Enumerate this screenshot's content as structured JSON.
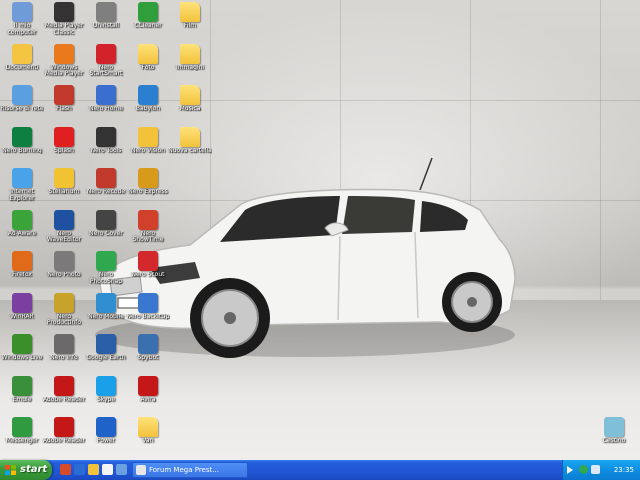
{
  "desktop": {
    "icons": [
      {
        "label": "Il mio computer",
        "kind": "computer",
        "color": "#6f9bd8"
      },
      {
        "label": "Media Player Classic",
        "kind": "media",
        "color": "#333333"
      },
      {
        "label": "Uninstall",
        "kind": "app",
        "color": "#7f7f7f"
      },
      {
        "label": "CCleaner",
        "kind": "app",
        "color": "#2f9e3b"
      },
      {
        "label": "Film",
        "kind": "folder",
        "color": "#f2c23b"
      },
      {
        "label": "Documenti",
        "kind": "docs",
        "color": "#f4c542"
      },
      {
        "label": "Windows Media Player",
        "kind": "media",
        "color": "#e87a1d"
      },
      {
        "label": "Nero StartSmart",
        "kind": "app",
        "color": "#d2232a"
      },
      {
        "label": "Foto",
        "kind": "folder",
        "color": "#f2c23b"
      },
      {
        "label": "Immagini",
        "kind": "folder",
        "color": "#f2c23b"
      },
      {
        "label": "Risorse di rete",
        "kind": "network",
        "color": "#5aa0e0"
      },
      {
        "label": "Flash",
        "kind": "app",
        "color": "#c0392b"
      },
      {
        "label": "Nero Home",
        "kind": "app",
        "color": "#3a6fd0"
      },
      {
        "label": "Babylon",
        "kind": "app",
        "color": "#2b7fd1"
      },
      {
        "label": "Musica",
        "kind": "folder",
        "color": "#f2c23b"
      },
      {
        "label": "Nero Burning",
        "kind": "app",
        "color": "#0f7f3f"
      },
      {
        "label": "Splash",
        "kind": "app",
        "color": "#e02020"
      },
      {
        "label": "Nero Tools",
        "kind": "app",
        "color": "#333333"
      },
      {
        "label": "Nero Vision",
        "kind": "app",
        "color": "#f2c23b"
      },
      {
        "label": "Nuova cartella",
        "kind": "folder",
        "color": "#f2c23b"
      },
      {
        "label": "Internet Explorer",
        "kind": "app",
        "color": "#4aa3e8"
      },
      {
        "label": "Stellarium",
        "kind": "app",
        "color": "#f1c232"
      },
      {
        "label": "Nero Recode",
        "kind": "app",
        "color": "#c0392b"
      },
      {
        "label": "Nero Express",
        "kind": "app",
        "color": "#d89a1a"
      },
      {
        "label": "Ad-Aware",
        "kind": "app",
        "color": "#3aa43a"
      },
      {
        "label": "Nero WaveEditor",
        "kind": "app",
        "color": "#2050a0"
      },
      {
        "label": "Nero Cover",
        "kind": "app",
        "color": "#444444"
      },
      {
        "label": "Nero ShowTime",
        "kind": "app",
        "color": "#d0402a"
      },
      {
        "label": "Firefox",
        "kind": "app",
        "color": "#e06a1a"
      },
      {
        "label": "Nero Photo",
        "kind": "app",
        "color": "#7a7a7a"
      },
      {
        "label": "Nero PhotoSnap",
        "kind": "app",
        "color": "#2fa84f"
      },
      {
        "label": "Nero Scout",
        "kind": "app",
        "color": "#d3282c"
      },
      {
        "label": "WinRAR",
        "kind": "app",
        "color": "#7a3fa0"
      },
      {
        "label": "Nero ProductInfo",
        "kind": "app",
        "color": "#c8a32a"
      },
      {
        "label": "Nero Mobile",
        "kind": "app",
        "color": "#2f8fd0"
      },
      {
        "label": "Nero BackItUp",
        "kind": "app",
        "color": "#3a78d0"
      },
      {
        "label": "Windows Live",
        "kind": "app",
        "color": "#3a8f2a"
      },
      {
        "label": "Nero Info",
        "kind": "app",
        "color": "#6a6a6a"
      },
      {
        "label": "Google Earth",
        "kind": "app",
        "color": "#2a5fa8"
      },
      {
        "label": "Spybot",
        "kind": "app",
        "color": "#3a6fb0"
      },
      {
        "label": "Emule",
        "kind": "app",
        "color": "#3a8f3a"
      },
      {
        "label": "Adobe Reader",
        "kind": "app",
        "color": "#c41818"
      },
      {
        "label": "Skype",
        "kind": "app",
        "color": "#1aa0e8"
      },
      {
        "label": "Avira",
        "kind": "app",
        "color": "#c41818"
      },
      {
        "label": "Messenger",
        "kind": "app",
        "color": "#2f9a3f"
      },
      {
        "label": "Adobe Reader",
        "kind": "app",
        "color": "#c41818"
      },
      {
        "label": "Power",
        "kind": "app",
        "color": "#1f63c9"
      },
      {
        "label": "Vari",
        "kind": "folder",
        "color": "#f2c23b"
      },
      {
        "label": "Cestino",
        "kind": "recycle",
        "color": "#7fbfd8"
      }
    ]
  },
  "taskbar": {
    "start_label": "start",
    "active_task": "Forum Mega Prest...",
    "clock": "23:35"
  },
  "colors": {
    "taskbar": "#245edb",
    "start": "#3c9b3c",
    "tray": "#0f8de0"
  }
}
